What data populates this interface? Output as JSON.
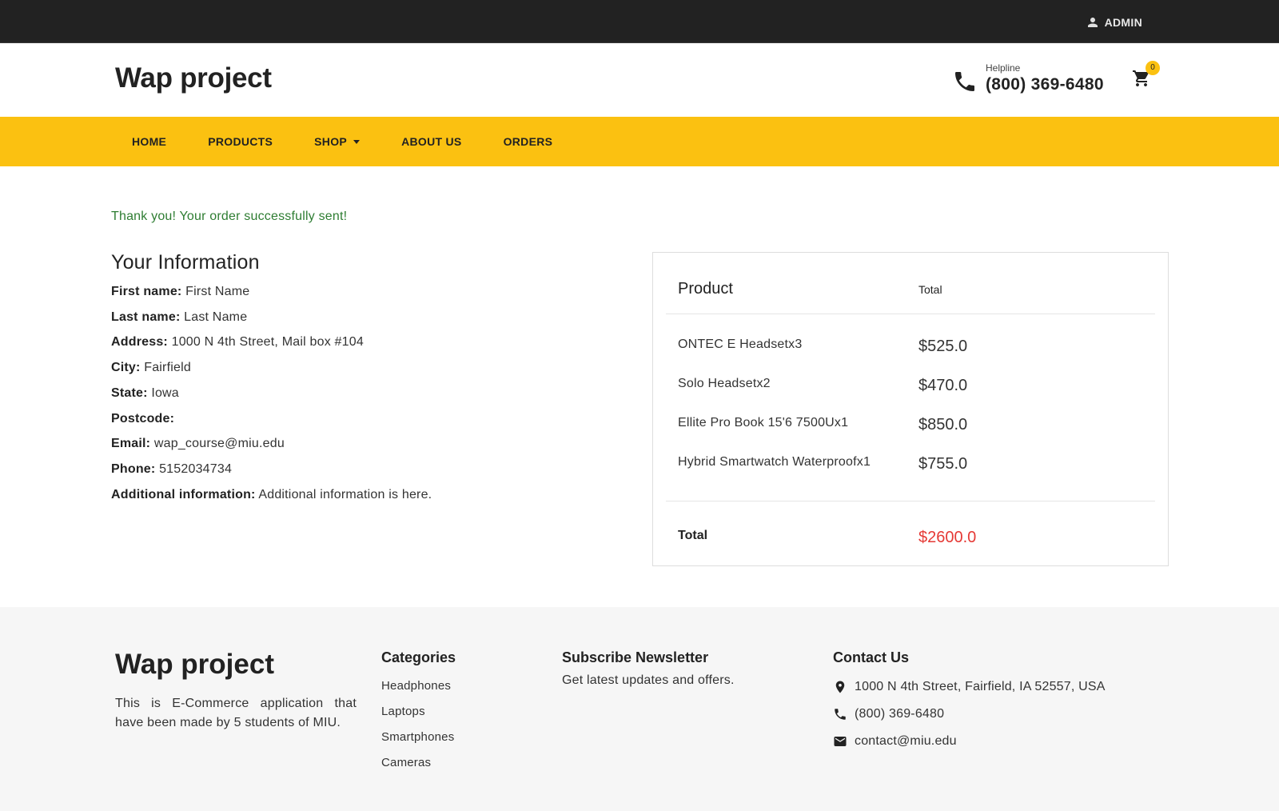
{
  "topbar": {
    "admin_label": "ADMIN",
    "admin_icon": "user-icon"
  },
  "header": {
    "logo": "Wap project",
    "helpline_label": "Helpline",
    "helpline_number": "(800) 369-6480",
    "cart_count": "0"
  },
  "nav": {
    "items": [
      {
        "label": "HOME"
      },
      {
        "label": "PRODUCTS"
      },
      {
        "label": "SHOP"
      },
      {
        "label": "ABOUT US"
      },
      {
        "label": "ORDERS"
      }
    ]
  },
  "main": {
    "success_message": "Thank you! Your order successfully sent!",
    "info_title": "Your Information",
    "info": [
      {
        "label": "First name:",
        "value": "First Name"
      },
      {
        "label": "Last name:",
        "value": "Last Name"
      },
      {
        "label": "Address:",
        "value": "1000 N 4th Street, Mail box #104"
      },
      {
        "label": "City:",
        "value": "Fairfield"
      },
      {
        "label": "State:",
        "value": "Iowa"
      },
      {
        "label": "Postcode:",
        "value": ""
      },
      {
        "label": "Email:",
        "value": "wap_course@miu.edu"
      },
      {
        "label": "Phone:",
        "value": "5152034734"
      },
      {
        "label": "Additional information:",
        "value": "Additional information is here."
      }
    ]
  },
  "order": {
    "product_header": "Product",
    "total_header": "Total",
    "items": [
      {
        "name": "ONTEC E Headsetx3",
        "price": "$525.0"
      },
      {
        "name": "Solo Headsetx2",
        "price": "$470.0"
      },
      {
        "name": "Ellite Pro Book 15'6 7500Ux1",
        "price": "$850.0"
      },
      {
        "name": "Hybrid Smartwatch Waterproofx1",
        "price": "$755.0"
      }
    ],
    "total_label": "Total",
    "total_value": "$2600.0"
  },
  "footer": {
    "logo": "Wap project",
    "description": "This is E-Commerce application that have been made by 5 students of MIU.",
    "categories_title": "Categories",
    "categories": [
      "Headphones",
      "Laptops",
      "Smartphones",
      "Cameras"
    ],
    "newsletter_title": "Subscribe Newsletter",
    "newsletter_text": "Get latest updates and offers.",
    "contact_title": "Contact Us",
    "contact_address": "1000 N 4th Street, Fairfield, IA 52557, USA",
    "contact_phone": "(800) 369-6480",
    "contact_email": "contact@miu.edu"
  },
  "colors": {
    "accent": "#fbc111",
    "topbar": "#222222",
    "success": "#2e7d32",
    "total_price": "#e53935",
    "footer_bg": "#f6f6f6"
  }
}
